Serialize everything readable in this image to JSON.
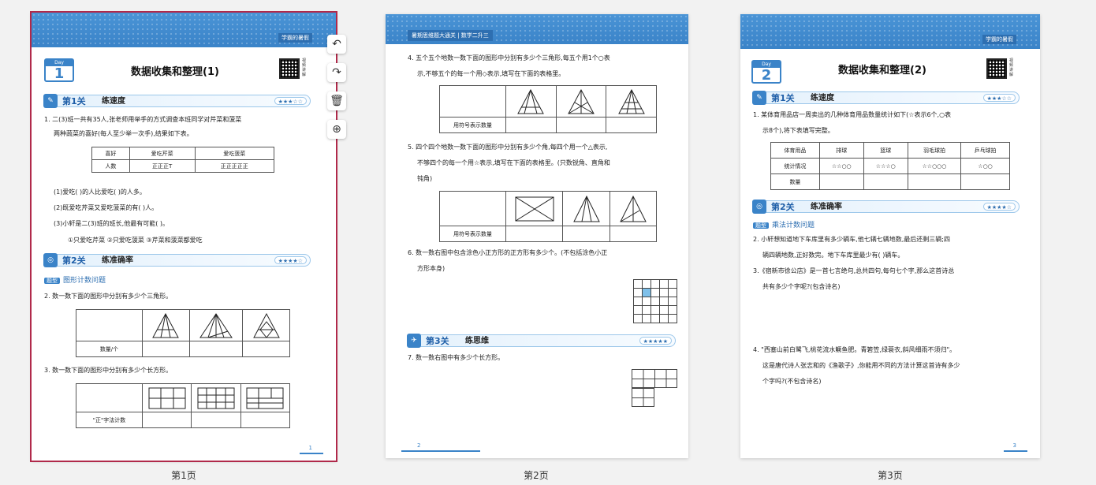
{
  "toolbar": {
    "rotate_left_icon": "↶",
    "rotate_right_icon": "↷",
    "delete_icon": "🗑",
    "add_icon": "⊕"
  },
  "pages": [
    {
      "caption": "第1页",
      "header_tag": "学霸的暑假",
      "day_label": "Day",
      "day_num": "1",
      "title": "数据收集和整理(1)",
      "qr_label": "视频讲解",
      "sec1": {
        "name": "第1关",
        "title": "练速度",
        "stars": "★★★☆☆"
      },
      "q1_l1": "1. 二(3)班一共有35人,张老师用举手的方式调查本班同学对芹菜和菠菜",
      "q1_l2": "两种蔬菜的喜好(每人至少举一次手),结果如下表。",
      "tbl1": {
        "h1": "喜好",
        "h2": "爱吃芹菜",
        "h3": "爱吃菠菜",
        "r1": "人数",
        "r2": "正正正T",
        "r3": "正正正正正"
      },
      "q1_a": "(1)爱吃(          )的人比爱吃(          )的人多。",
      "q1_b": "(2)既爱吃芹菜又爱吃菠菜的有(          )人。",
      "q1_c": "(3)小轩是二(3)班的班长,他最有可能(          )。",
      "q1_opts": "①只爱吃芹菜        ②只爱吃菠菜        ③芹菜和菠菜都爱吃",
      "sec2": {
        "name": "第2关",
        "title": "练准确率",
        "stars": "★★★★☆"
      },
      "topic_badge": "题型",
      "topic": "图形计数问题",
      "q2": "2. 数一数下面的图形中分别有多少个三角形。",
      "q2_row": "数量/个",
      "q3": "3. 数一数下面的图形中分别有多少个长方形。",
      "q3_row": "\"正\"字法计数",
      "page_no": "1"
    },
    {
      "caption": "第2页",
      "header_tag": "暑期思维题大通关 | 数学二升三",
      "q4_l1": "4. 五个五个地数一数下面的图形中分别有多少个三角形,每五个用1个○表",
      "q4_l2": "示,不够五个的每一个用◇表示,填写在下面的表格里。",
      "q4_row": "用符号表示数量",
      "q5_l1": "5. 四个四个地数一数下面的图形中分别有多少个角,每四个用一个△表示,",
      "q5_l2": "不够四个的每一个用☆表示,填写在下面的表格里。(只数锐角、直角和",
      "q5_l3": "钝角)",
      "q5_row": "用符号表示数量",
      "q6_l1": "6. 数一数右图中包含涂色小正方形的正方形有多少个。(不包括涂色小正",
      "q6_l2": "方形本身)",
      "sec3": {
        "name": "第3关",
        "title": "练思维",
        "stars": "★★★★★"
      },
      "q7": "7. 数一数右图中有多少个长方形。",
      "page_no": "2"
    },
    {
      "caption": "第3页",
      "header_tag": "学霸的暑假",
      "day_label": "Day",
      "day_num": "2",
      "title": "数据收集和整理(2)",
      "qr_label": "视频讲解",
      "sec1": {
        "name": "第1关",
        "title": "练速度",
        "stars": "★★★☆☆"
      },
      "q1_l1": "1. 某体育用品店一周卖出的几种体育用品数量统计如下(☆表示6个,○表",
      "q1_l2": "示8个),将下表填写完整。",
      "tbl": {
        "h": [
          "体育用品",
          "排球",
          "篮球",
          "羽毛球拍",
          "乒乓球拍"
        ],
        "r1": [
          "统计情况",
          "☆☆○○",
          "☆☆☆○",
          "☆☆○○○",
          "☆○○"
        ],
        "r2": [
          "数量",
          "",
          "",
          "",
          ""
        ]
      },
      "sec2": {
        "name": "第2关",
        "title": "练准确率",
        "stars": "★★★★☆"
      },
      "topic_badge": "题型",
      "topic": "乘法计数问题",
      "q2_l1": "2. 小轩想知道地下车库里有多少辆车,他七辆七辆地数,最后还剩三辆;四",
      "q2_l2": "辆四辆地数,正好数完。地下车库里最少有(          )辆车。",
      "q3_l1": "3.《宿新市徐公店》是一首七言绝句,总共四句,每句七个字,那么这首诗总",
      "q3_l2": "共有多少个字呢?(包含诗名)",
      "q4_l1": "4. \"西塞山前白鹭飞,桃花流水鳜鱼肥。青箬笠,绿蓑衣,斜风细雨不须归\"。",
      "q4_l2": "这是唐代诗人张志和的《渔歌子》,你能用不同的方法计算这首诗有多少",
      "q4_l3": "个字吗?(不包含诗名)",
      "page_no": "3"
    }
  ]
}
